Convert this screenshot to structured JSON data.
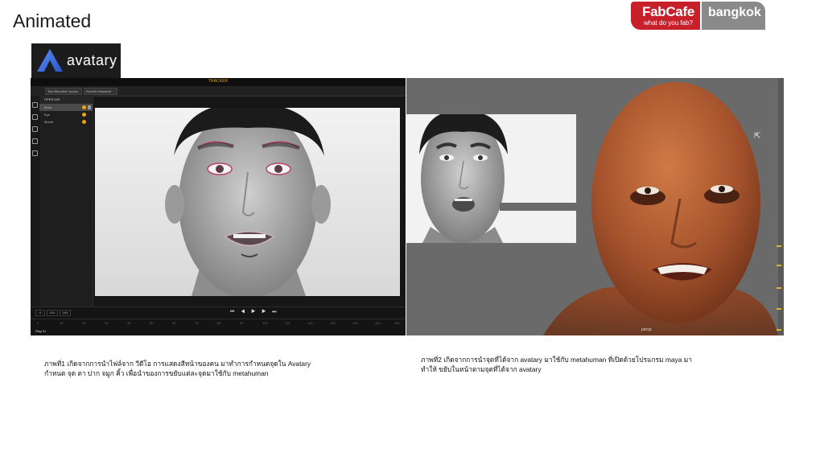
{
  "slide": {
    "title": "Animated"
  },
  "brand": {
    "fabcafe": "FabCafe",
    "tagline": "what do you fab?",
    "city": "bangkok",
    "colors": {
      "red": "#c8202b",
      "grey": "#8a8a8a"
    }
  },
  "avatary_logo": {
    "text": "avatary",
    "icon": "avatary-a-icon"
  },
  "left_shot": {
    "app_name": "TRACKER",
    "toolbar": [
      "Text Blendset: source",
      "Smooth Standard"
    ],
    "panel_header": "OPEN DIR",
    "panel_rows": [
      "Brow",
      "Eye",
      "Mouth"
    ],
    "tl_fields": [
      "0",
      "100",
      "164"
    ],
    "ruler": [
      "0",
      "10",
      "20",
      "30",
      "40",
      "50",
      "60",
      "70",
      "80",
      "90",
      "100",
      "110",
      "120",
      "130",
      "140",
      "150",
      "160"
    ],
    "play_label": "Play 01"
  },
  "right_shot": {
    "camera_label": "persp"
  },
  "captions": {
    "left": "ภาพที่1 เกิดจากการนำไฟล์จาก วีดีโอ การแสดงสีหน้าของคน มาทำการกำหนดจุดใน Avatary กำหนด จุด ตา ปาก จมูก คิ้ว เพื่อนำของการขยับแต่ละจุดมาใช้กับ metahuman",
    "right": "ภาพที่2 เกิดจากการนำจุดที่ได้จาก avatary มาใช้กับ metahuman ที่เปิดด้วยโปรแกรม maya มาทำให้ ขยับในหน้าตามจุดที่ได้จาก avatary"
  }
}
